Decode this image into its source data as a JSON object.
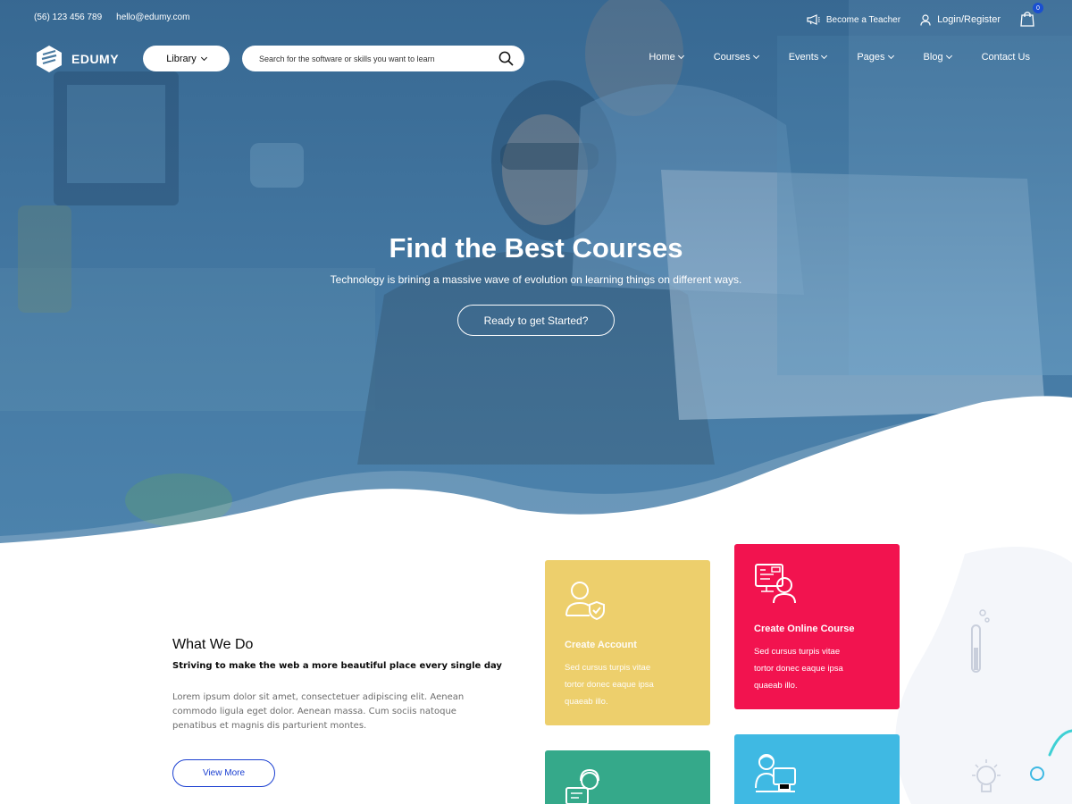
{
  "topbar": {
    "phone": "(56) 123 456 789",
    "email": "hello@edumy.com",
    "become_teacher": "Become a Teacher",
    "login": "Login/Register",
    "cart_count": "0"
  },
  "navbar": {
    "brand": "EDUMY",
    "library": "Library",
    "search_placeholder": "Search for the software or skills you want to learn",
    "menu": [
      "Home",
      "Courses",
      "Events",
      "Pages",
      "Blog",
      "Contact Us"
    ]
  },
  "hero": {
    "title": "Find the Best Courses",
    "subtitle": "Technology is brining a massive wave of evolution on learning things on different ways.",
    "cta": "Ready to get Started?"
  },
  "what_we_do": {
    "title": "What We Do",
    "subtitle": "Striving to make the web a more beautiful place every single day",
    "body": "Lorem ipsum dolor sit amet, consectetuer adipiscing elit. Aenean commodo ligula eget dolor. Aenean massa. Cum sociis natoque penatibus et magnis dis parturient montes.",
    "button": "View More"
  },
  "cards": [
    {
      "title": "Create Account",
      "desc": "Sed cursus turpis vitae tortor donec eaque ipsa quaeab illo.",
      "color": "#edcf6c",
      "icon": "user-shield-icon"
    },
    {
      "title": "Create Online Course",
      "desc": "Sed cursus turpis vitae tortor donec eaque ipsa quaeab illo.",
      "color": "#f2134f",
      "icon": "online-course-icon"
    },
    {
      "title": "",
      "desc": "",
      "color": "#35a98a",
      "icon": "support-agent-icon"
    },
    {
      "title": "",
      "desc": "",
      "color": "#3fb9e3",
      "icon": "computer-user-icon"
    }
  ],
  "colors": {
    "accent": "#1a3fd1",
    "hero_blue": "#4d7ea3"
  }
}
